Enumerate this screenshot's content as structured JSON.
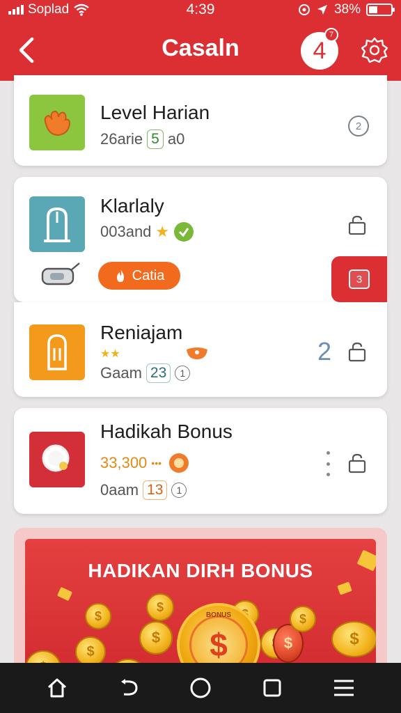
{
  "status_bar": {
    "carrier": "Soplad",
    "time": "4:39",
    "battery": "38%"
  },
  "header": {
    "title": "Casaln",
    "notification_count": "4",
    "notification_badge": "7"
  },
  "cards": [
    {
      "title": "Level Harian",
      "sub_prefix": "26arie",
      "sub_pill": "5",
      "sub_suffix": "a0",
      "info": "2"
    },
    {
      "title": "Klarlaly",
      "sub_prefix": "003and",
      "claim_label": "Catia",
      "tab_label": "3"
    },
    {
      "title": "Reniajam",
      "stars": "★★",
      "sub_prefix": "Gaam",
      "sub_pill": "23",
      "sub_circle": "1",
      "count": "2"
    },
    {
      "title": "Hadikah Bonus",
      "amount": "33,300",
      "amount_dots": "•••",
      "sub_prefix": "0aam",
      "sub_pill": "13",
      "sub_circle": "1"
    }
  ],
  "banner": {
    "title": "HADIKAN DIRH BONUS",
    "coin_text": "BONUS",
    "coin_symbol": "$"
  },
  "colors": {
    "primary": "#dc2f33",
    "orange": "#f26a1e",
    "gold": "#f2b21b"
  },
  "icons": [
    "back-icon",
    "settings-icon",
    "lock-icon",
    "home-icon",
    "back-nav-icon",
    "circle-home-icon",
    "recents-icon",
    "menu-icon"
  ]
}
